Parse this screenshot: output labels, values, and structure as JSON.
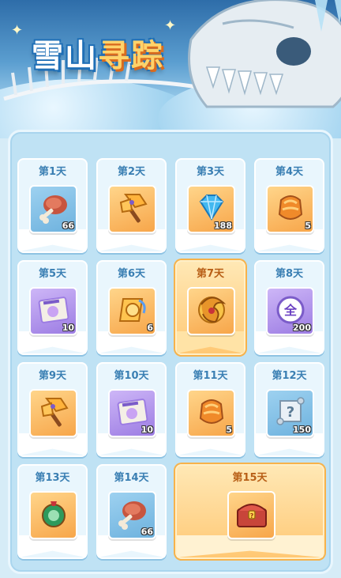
{
  "event": {
    "title_part1": "雪山",
    "title_part2": "寻踪"
  },
  "rewards": [
    {
      "day": "第1天",
      "item": "meat-icon",
      "qty": "66",
      "bg": "blue"
    },
    {
      "day": "第2天",
      "item": "battle-axe-icon",
      "qty": "",
      "bg": "orange"
    },
    {
      "day": "第3天",
      "item": "diamond-icon",
      "qty": "188",
      "bg": "orange"
    },
    {
      "day": "第4天",
      "item": "armor-icon",
      "qty": "5",
      "bg": "orange"
    },
    {
      "day": "第5天",
      "item": "ticket-icon",
      "qty": "10",
      "bg": "purple"
    },
    {
      "day": "第6天",
      "item": "scroll-badge-icon",
      "qty": "6",
      "bg": "orange"
    },
    {
      "day": "第7天",
      "item": "golden-dragon-icon",
      "qty": "",
      "bg": "orange",
      "special": true
    },
    {
      "day": "第8天",
      "item": "all-badge-icon",
      "qty": "200",
      "bg": "purple",
      "badge_text": "全"
    },
    {
      "day": "第9天",
      "item": "battle-axe-icon",
      "qty": "",
      "bg": "orange"
    },
    {
      "day": "第10天",
      "item": "ticket-icon",
      "qty": "10",
      "bg": "purple"
    },
    {
      "day": "第11天",
      "item": "armor-icon",
      "qty": "5",
      "bg": "orange"
    },
    {
      "day": "第12天",
      "item": "mystery-scroll-icon",
      "qty": "150",
      "bg": "blue"
    },
    {
      "day": "第13天",
      "item": "jade-ring-icon",
      "qty": "",
      "bg": "orange"
    },
    {
      "day": "第14天",
      "item": "meat-icon",
      "qty": "66",
      "bg": "blue"
    },
    {
      "day": "第15天",
      "item": "treasure-chest-icon",
      "qty": "",
      "bg": "orange",
      "final": true
    }
  ]
}
